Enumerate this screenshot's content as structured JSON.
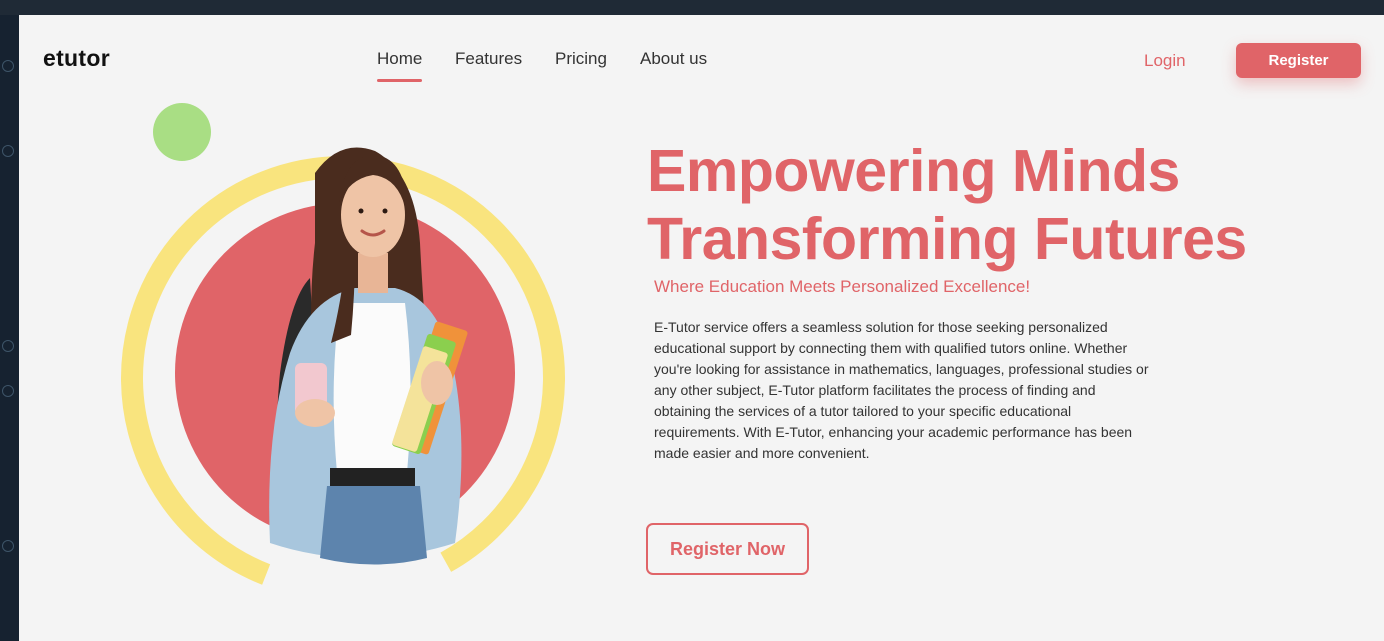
{
  "brand": {
    "name": "etutor"
  },
  "nav": {
    "items": [
      {
        "label": "Home",
        "active": true
      },
      {
        "label": "Features",
        "active": false
      },
      {
        "label": "Pricing",
        "active": false
      },
      {
        "label": "About us",
        "active": false
      }
    ]
  },
  "auth": {
    "login_label": "Login",
    "register_label": "Register"
  },
  "hero": {
    "headline_line1": "Empowering Minds",
    "headline_line2": "Transforming Futures",
    "subheadline": "Where Education Meets Personalized Excellence!",
    "description": "E-Tutor service offers a seamless solution for those seeking personalized educational support by connecting them with qualified tutors online. Whether you're looking for assistance in mathematics, languages, professional studies or any other subject, E-Tutor platform facilitates the process of finding and obtaining the services of a tutor tailored to your specific educational requirements. With E-Tutor, enhancing your academic performance has been made easier and more convenient.",
    "cta_label": "Register Now",
    "image_icon": "student-illustration"
  },
  "colors": {
    "accent": "#e06468",
    "ring": "#f9e47e",
    "dot": "#a9de84",
    "background": "#f4f4f4"
  }
}
